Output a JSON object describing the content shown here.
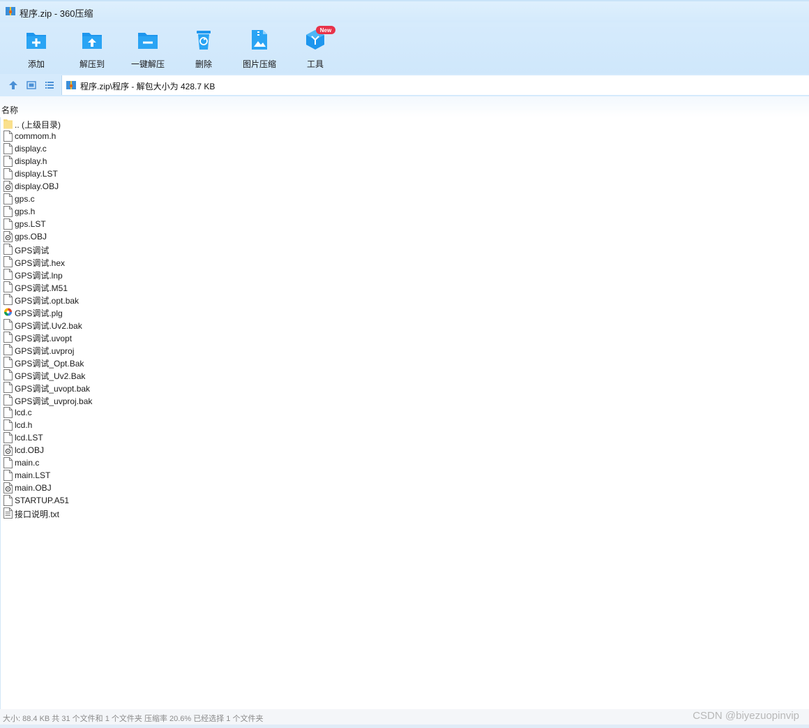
{
  "window": {
    "title": "程序.zip - 360压缩"
  },
  "toolbar": {
    "buttons": [
      {
        "label": "添加",
        "icon": "folder-add-icon"
      },
      {
        "label": "解压到",
        "icon": "folder-extract-icon"
      },
      {
        "label": "一键解压",
        "icon": "folder-quick-extract-icon"
      },
      {
        "label": "删除",
        "icon": "trash-icon"
      },
      {
        "label": "图片压缩",
        "icon": "image-compress-icon"
      },
      {
        "label": "工具",
        "icon": "tools-cube-icon",
        "badge": "New"
      }
    ]
  },
  "address": {
    "path": "程序.zip\\程序 - 解包大小为 428.7 KB"
  },
  "list": {
    "column_name": "名称",
    "files": [
      {
        "name": ".. (上级目录)",
        "icon": "folder"
      },
      {
        "name": "commom.h",
        "icon": "file"
      },
      {
        "name": "display.c",
        "icon": "file"
      },
      {
        "name": "display.h",
        "icon": "file"
      },
      {
        "name": "display.LST",
        "icon": "file"
      },
      {
        "name": "display.OBJ",
        "icon": "obj"
      },
      {
        "name": "gps.c",
        "icon": "file"
      },
      {
        "name": "gps.h",
        "icon": "file"
      },
      {
        "name": "gps.LST",
        "icon": "file"
      },
      {
        "name": "gps.OBJ",
        "icon": "obj"
      },
      {
        "name": "GPS调试",
        "icon": "file"
      },
      {
        "name": "GPS调试.hex",
        "icon": "file"
      },
      {
        "name": "GPS调试.lnp",
        "icon": "file"
      },
      {
        "name": "GPS调试.M51",
        "icon": "file"
      },
      {
        "name": "GPS调试.opt.bak",
        "icon": "file"
      },
      {
        "name": "GPS调试.plg",
        "icon": "plg"
      },
      {
        "name": "GPS调试.Uv2.bak",
        "icon": "file"
      },
      {
        "name": "GPS调试.uvopt",
        "icon": "file"
      },
      {
        "name": "GPS调试.uvproj",
        "icon": "file"
      },
      {
        "name": "GPS调试_Opt.Bak",
        "icon": "file"
      },
      {
        "name": "GPS调试_Uv2.Bak",
        "icon": "file"
      },
      {
        "name": "GPS调试_uvopt.bak",
        "icon": "file"
      },
      {
        "name": "GPS调试_uvproj.bak",
        "icon": "file"
      },
      {
        "name": "lcd.c",
        "icon": "file"
      },
      {
        "name": "lcd.h",
        "icon": "file"
      },
      {
        "name": "lcd.LST",
        "icon": "file"
      },
      {
        "name": "lcd.OBJ",
        "icon": "obj"
      },
      {
        "name": "main.c",
        "icon": "file"
      },
      {
        "name": "main.LST",
        "icon": "file"
      },
      {
        "name": "main.OBJ",
        "icon": "obj"
      },
      {
        "name": "STARTUP.A51",
        "icon": "file"
      },
      {
        "name": "接口说明.txt",
        "icon": "txt"
      }
    ]
  },
  "status": {
    "text": "大小: 88.4 KB 共 31 个文件和 1 个文件夹 压缩率 20.6% 已经选择 1 个文件夹",
    "watermark": "CSDN @biyezuopinvip"
  },
  "colors": {
    "accent": "#1e96ee",
    "toolbar_bg": "#d6ebfc",
    "badge": "#e8334a"
  }
}
